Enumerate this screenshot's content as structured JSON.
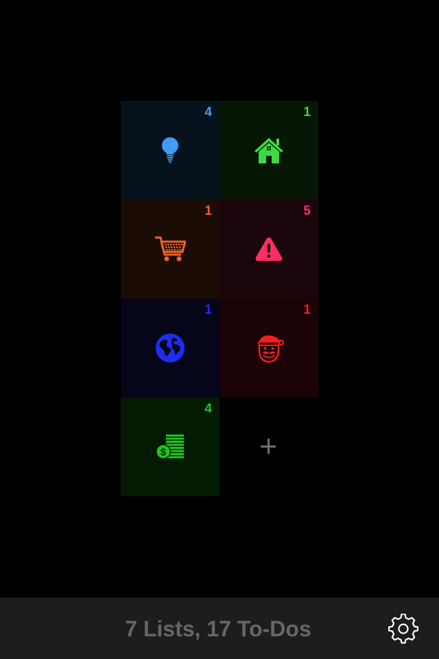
{
  "lists": [
    {
      "id": "ideas",
      "count": "4",
      "icon": "lightbulb-icon",
      "color": "#3f9bf5",
      "bg": "#06131d"
    },
    {
      "id": "home",
      "count": "1",
      "icon": "house-icon",
      "color": "#3ed93e",
      "bg": "#061706"
    },
    {
      "id": "shopping",
      "count": "1",
      "icon": "shopping-cart-icon",
      "color": "#f2622b",
      "bg": "#1b0c06"
    },
    {
      "id": "urgent",
      "count": "5",
      "icon": "warning-icon",
      "color": "#ff2d61",
      "bg": "#1b060b"
    },
    {
      "id": "world",
      "count": "1",
      "icon": "globe-icon",
      "color": "#1d2ef2",
      "bg": "#050619"
    },
    {
      "id": "christmas",
      "count": "1",
      "icon": "santa-icon",
      "color": "#ff1b1b",
      "bg": "#1c0305"
    },
    {
      "id": "money",
      "count": "4",
      "icon": "money-icon",
      "color": "#1fc61f",
      "bg": "#031a03"
    }
  ],
  "add_tile": {
    "icon": "plus-icon"
  },
  "footer": {
    "summary": "7 Lists, 17 To-Dos",
    "settings_icon": "gear-icon"
  }
}
